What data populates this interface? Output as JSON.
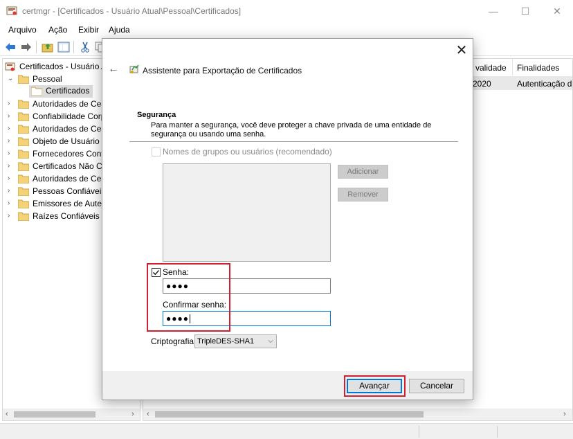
{
  "window": {
    "title": "certmgr - [Certificados - Usuário Atual\\Pessoal\\Certificados]",
    "minimize": "—",
    "maximize": "☐",
    "close": "✕"
  },
  "menu": [
    "Arquivo",
    "Ação",
    "Exibir",
    "Ajuda"
  ],
  "tree": {
    "root": "Certificados - Usuário Atual",
    "items": [
      {
        "label": "Pessoal",
        "expanded": true
      },
      {
        "label": "Certificados",
        "child": true,
        "selected": true
      },
      {
        "label": "Autoridades de Certificação Raiz Confiáveis"
      },
      {
        "label": "Confiabilidade Corporativa"
      },
      {
        "label": "Autoridades de Certificação Intermediárias"
      },
      {
        "label": "Objeto de Usuário do Active Directory"
      },
      {
        "label": "Fornecedores Confiáveis"
      },
      {
        "label": "Certificados Não Confiáveis"
      },
      {
        "label": "Autoridades de Certificação Raiz de Terceiros"
      },
      {
        "label": "Pessoas Confiáveis"
      },
      {
        "label": "Emissores de Autenticação de Cliente"
      },
      {
        "label": "Raízes Confiáveis de Cartão Inteligente"
      }
    ]
  },
  "list": {
    "columns": [
      "Data de validade",
      "Finalidades"
    ],
    "visible_headers": [
      "e validade",
      "Finalidades"
    ],
    "row": [
      "2020",
      "Autenticação d"
    ]
  },
  "dialog": {
    "title": "Assistente para Exportação de Certificados",
    "close": "✕",
    "back": "←",
    "section_title": "Segurança",
    "section_desc": "Para manter a segurança, você deve proteger a chave privada de uma entidade de segurança ou usando uma senha.",
    "groups_checkbox": "Nomes de grupos ou usuários (recomendado)",
    "add_button": "Adicionar",
    "remove_button": "Remover",
    "password_checkbox": "Senha:",
    "password_value": "●●●●",
    "confirm_label": "Confirmar senha:",
    "confirm_value": "●●●●",
    "crypto_label": "Criptografia:",
    "crypto_value": "TripleDES-SHA1",
    "next_button": "Avançar",
    "cancel_button": "Cancelar"
  },
  "colors": {
    "highlight": "#d21f2f",
    "focus": "#0078d7"
  }
}
